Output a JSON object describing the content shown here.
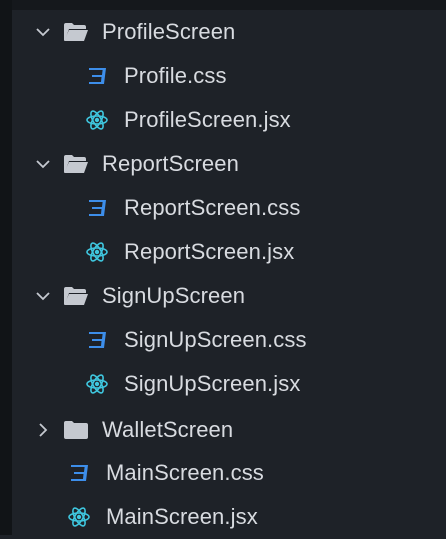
{
  "explorer": {
    "items": [
      {
        "type": "folder",
        "label": "ProfileScreen",
        "expanded": true,
        "depth": 0
      },
      {
        "type": "css",
        "label": "Profile.css",
        "depth": 1
      },
      {
        "type": "jsx",
        "label": "ProfileScreen.jsx",
        "depth": 1
      },
      {
        "type": "folder",
        "label": "ReportScreen",
        "expanded": true,
        "depth": 0
      },
      {
        "type": "css",
        "label": "ReportScreen.css",
        "depth": 1
      },
      {
        "type": "jsx",
        "label": "ReportScreen.jsx",
        "depth": 1
      },
      {
        "type": "folder",
        "label": "SignUpScreen",
        "expanded": true,
        "depth": 0
      },
      {
        "type": "css",
        "label": "SignUpScreen.css",
        "depth": 1
      },
      {
        "type": "jsx",
        "label": "SignUpScreen.jsx",
        "depth": 1
      },
      {
        "type": "folder",
        "label": "WalletScreen",
        "expanded": false,
        "depth": 0
      },
      {
        "type": "css",
        "label": "MainScreen.css",
        "depth": 0
      },
      {
        "type": "jsx",
        "label": "MainScreen.jsx",
        "depth": 0
      }
    ]
  },
  "colors": {
    "background": "#1e2228",
    "text": "#d8dbe0",
    "folder": "#c5c9d0",
    "css": "#3d8eea",
    "react": "#3fc7df"
  }
}
